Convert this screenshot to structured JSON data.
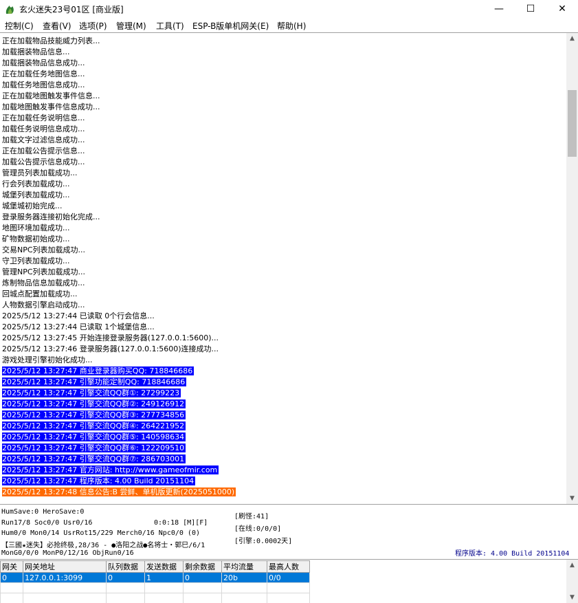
{
  "window": {
    "title": "玄火迷失23号01区 [商业版]",
    "minimize_glyph": "—",
    "maximize_glyph": "☐",
    "close_glyph": "✕"
  },
  "menu": [
    {
      "label": "控制(C)"
    },
    {
      "label": "查看(V)"
    },
    {
      "label": "选项(P)"
    },
    {
      "label": "管理(M)"
    },
    {
      "label": "工具(T)"
    },
    {
      "label": "ESP-B版单机网关(E)"
    },
    {
      "label": "帮助(H)"
    }
  ],
  "log": {
    "lines": [
      {
        "text": "正在加载物品技能威力列表...",
        "style": "normal"
      },
      {
        "text": "加载捆装物品信息...",
        "style": "normal"
      },
      {
        "text": "加载捆装物品信息成功...",
        "style": "normal"
      },
      {
        "text": "正在加载任务地图信息...",
        "style": "normal"
      },
      {
        "text": "加载任务地图信息成功...",
        "style": "normal"
      },
      {
        "text": "正在加载地图触发事件信息...",
        "style": "normal"
      },
      {
        "text": "加载地图触发事件信息成功...",
        "style": "normal"
      },
      {
        "text": "正在加载任务说明信息...",
        "style": "normal"
      },
      {
        "text": "加载任务说明信息成功...",
        "style": "normal"
      },
      {
        "text": "加载文字过滤信息成功...",
        "style": "normal"
      },
      {
        "text": "正在加载公告提示信息...",
        "style": "normal"
      },
      {
        "text": "加载公告提示信息成功...",
        "style": "normal"
      },
      {
        "text": "管理员列表加载成功...",
        "style": "normal"
      },
      {
        "text": "行会列表加载成功...",
        "style": "normal"
      },
      {
        "text": "城堡列表加载成功...",
        "style": "normal"
      },
      {
        "text": "城堡城初始完成...",
        "style": "normal"
      },
      {
        "text": "登录服务器连接初始化完成...",
        "style": "normal"
      },
      {
        "text": "地图环境加载成功...",
        "style": "normal"
      },
      {
        "text": "矿物数据初始成功...",
        "style": "normal"
      },
      {
        "text": "交易NPC列表加载成功...",
        "style": "normal"
      },
      {
        "text": "守卫列表加载成功...",
        "style": "normal"
      },
      {
        "text": "管理NPC列表加载成功...",
        "style": "normal"
      },
      {
        "text": "炼制物品信息加载成功...",
        "style": "normal"
      },
      {
        "text": "回城点配置加载成功...",
        "style": "normal"
      },
      {
        "text": "人物数据引擎启动成功...",
        "style": "normal"
      },
      {
        "text": "2025/5/12 13:27:44 已读取 0个行会信息...",
        "style": "normal"
      },
      {
        "text": "2025/5/12 13:27:44 已读取 1个城堡信息...",
        "style": "normal"
      },
      {
        "text": "2025/5/12 13:27:45 开始连接登录服务器(127.0.0.1:5600)...",
        "style": "normal"
      },
      {
        "text": "2025/5/12 13:27:46 登录服务器(127.0.0.1:5600)连接成功...",
        "style": "normal"
      },
      {
        "text": "游戏处理引擎初始化成功...",
        "style": "normal"
      },
      {
        "text": "2025/5/12 13:27:47 商业登录器购买QQ: 718846686",
        "style": "selected"
      },
      {
        "text": "2025/5/12 13:27:47 引擎功能定制QQ: 718846686",
        "style": "selected"
      },
      {
        "text": "2025/5/12 13:27:47 引擎交流QQ群①: 27299223",
        "style": "selected"
      },
      {
        "text": "2025/5/12 13:27:47 引擎交流QQ群②: 249126912",
        "style": "selected"
      },
      {
        "text": "2025/5/12 13:27:47 引擎交流QQ群③: 277734856",
        "style": "selected"
      },
      {
        "text": "2025/5/12 13:27:47 引擎交流QQ群④: 264221952",
        "style": "selected"
      },
      {
        "text": "2025/5/12 13:27:47 引擎交流QQ群⑤: 140598634",
        "style": "selected"
      },
      {
        "text": "2025/5/12 13:27:47 引擎交流QQ群⑥: 122209510",
        "style": "selected"
      },
      {
        "text": "2025/5/12 13:27:47 引擎交流QQ群⑦: 286703001",
        "style": "selected"
      },
      {
        "text": "2025/5/12 13:27:47 官方网站: http://www.gameofmir.com",
        "style": "selected"
      },
      {
        "text": "2025/5/12 13:27:47 程序版本: 4.00 Build 20151104",
        "style": "selected"
      },
      {
        "text": "2025/5/12 13:27:48 信息公告:B 尝鲜、单机版更新(2025051000)",
        "style": "highlight"
      }
    ],
    "scroll_up_glyph": "▲",
    "scroll_down_glyph": "▼"
  },
  "status": {
    "hum_save": "HumSave:0 HeroSave:0",
    "run": "Run17/8 Soc0/0 Usr0/16",
    "time": "0:0:18 [M][F]",
    "hum": "Hum0/0 Mon0/14 UsrRot15/229 Merch0/16 Npc0/0 (0)",
    "announce": "【三國★迷失】必抢终极,28/36 - ●洛阳之战●名将士・郭巳/6/1",
    "mon": "MonG0/0/0 MonP0/12/16 ObjRun0/16",
    "refresh_monster": "[刷怪:41]",
    "online": "[在线:0/0/0]",
    "engine": "[引擎:0.0002天]",
    "build_version": "程序版本: 4.00 Build 20151104"
  },
  "gateway_table": {
    "columns": [
      "网关",
      "网关地址",
      "队列数据",
      "发送数据",
      "剩余数据",
      "平均流量",
      "最高人数"
    ],
    "rows": [
      [
        "0",
        "127.0.0.1:3099",
        "0",
        "1",
        "0",
        "20b",
        "0/0"
      ]
    ],
    "scroll_up_glyph": "▲",
    "scroll_down_glyph": "▼"
  },
  "colors": {
    "selection_bg": "#0000ff",
    "highlight_bg": "#ff6a00",
    "grid_selection_bg": "#0078d7",
    "version_text": "#00008b"
  }
}
